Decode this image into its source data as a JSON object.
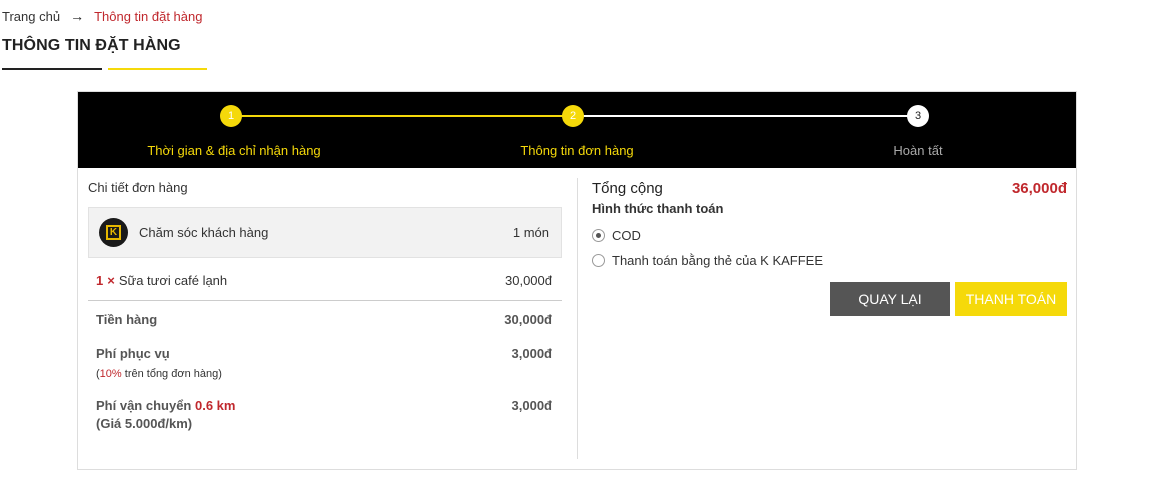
{
  "breadcrumb": {
    "home": "Trang chủ",
    "separator": "→",
    "current": "Thông tin đặt hàng"
  },
  "page_title": "THÔNG TIN ĐẶT HÀNG",
  "steps": [
    {
      "number": "1",
      "label": "Thời gian & địa chỉ nhận hàng",
      "state": "done"
    },
    {
      "number": "2",
      "label": "Thông tin đơn hàng",
      "state": "done"
    },
    {
      "number": "3",
      "label": "Hoàn tất",
      "state": "todo"
    }
  ],
  "order": {
    "heading": "Chi tiết đơn hàng",
    "store": {
      "name": "Chăm sóc khách hàng",
      "count": "1 món",
      "logo_letter": "K"
    },
    "items": [
      {
        "qty": "1",
        "x": "×",
        "name": "Sữa tươi café lạnh",
        "price": "30,000đ"
      }
    ],
    "subtotal": {
      "label": "Tiền hàng",
      "value": "30,000đ"
    },
    "service": {
      "label": "Phí phục vụ",
      "value": "3,000đ",
      "note_open": "(",
      "note_pct": "10%",
      "note_rest": " trên tổng đơn hàng)"
    },
    "shipping": {
      "label": "Phí vận chuyển",
      "distance": "0.6 km",
      "rate": "(Giá 5.000đ/km)",
      "value": "3,000đ"
    }
  },
  "summary": {
    "total_label": "Tổng cộng",
    "total_amount": "36,000đ",
    "payment_heading": "Hình thức thanh toán",
    "payment_options": [
      {
        "label": "COD",
        "checked": true
      },
      {
        "label": "Thanh toán bằng thẻ của K KAFFEE",
        "checked": false
      }
    ],
    "back_button": "QUAY LẠI",
    "pay_button": "THANH TOÁN"
  },
  "colors": {
    "accent_yellow": "#f5d90a",
    "price_red": "#c0282d",
    "stepper_bg": "#000000",
    "back_button": "#555555"
  }
}
